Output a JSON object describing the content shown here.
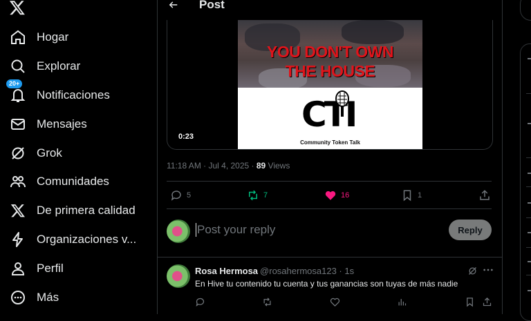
{
  "nav": {
    "items": [
      {
        "label": "Hogar",
        "icon": "home-icon"
      },
      {
        "label": "Explorar",
        "icon": "search-icon"
      },
      {
        "label": "Notificaciones",
        "icon": "bell-icon",
        "badge": "20+"
      },
      {
        "label": "Mensajes",
        "icon": "mail-icon"
      },
      {
        "label": "Grok",
        "icon": "grok-icon"
      },
      {
        "label": "Comunidades",
        "icon": "communities-icon"
      },
      {
        "label": "De primera calidad",
        "icon": "x-premium-icon"
      },
      {
        "label": "Organizaciones v...",
        "icon": "lightning-icon"
      },
      {
        "label": "Perfil",
        "icon": "person-icon"
      },
      {
        "label": "Más",
        "icon": "more-circle-icon"
      }
    ]
  },
  "header": {
    "title": "Post"
  },
  "video": {
    "headline_line1": "YOU DON'T OWN",
    "headline_line2": "THE HOUSE",
    "logo_text": "CTI",
    "logo_subtitle": "Community Token Talk",
    "duration": "0:23"
  },
  "post_meta": {
    "time": "11:18 AM · Jul 4, 2025 · ",
    "views_count": "89",
    "views_label": " Views"
  },
  "actions": {
    "replies": "5",
    "reposts": "7",
    "likes": "16",
    "bookmarks": "1"
  },
  "reply": {
    "placeholder": "Post your reply",
    "button": "Reply"
  },
  "comment": {
    "name": "Rosa Hermosa",
    "handle": "@rosahermosa123 · 1s",
    "text": "En Hive tu contenido tu cuenta y tus ganancias son tuyas de más nadie"
  },
  "colors": {
    "accent": "#1d9bf0",
    "like": "#f91880",
    "repost": "#00ba7c",
    "headline": "#e0141b"
  }
}
